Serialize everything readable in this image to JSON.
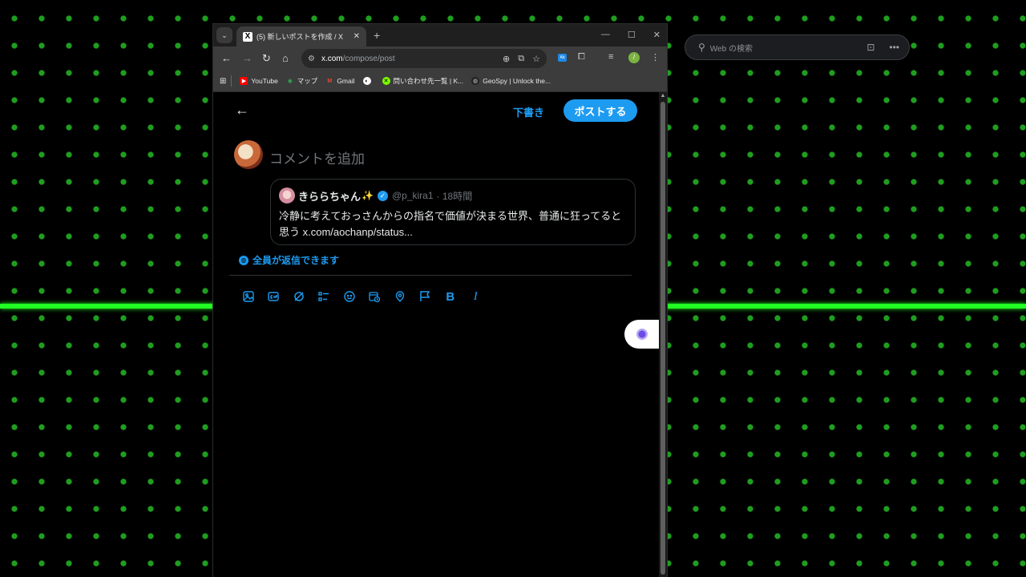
{
  "desktop": {
    "search_placeholder": "Web の検索"
  },
  "browser": {
    "tab_title": "(5) 新しいポストを作成 / X",
    "tab_favicon": "X",
    "url_host": "x.com",
    "url_path": "/compose/post",
    "bookmarks": [
      {
        "label": "YouTube",
        "color": "#ff0000"
      },
      {
        "label": "マップ",
        "color": "#34a853"
      },
      {
        "label": "Gmail",
        "color": "#ea4335"
      },
      {
        "label": "",
        "color": "#ffffff"
      },
      {
        "label": "問い合わせ先一覧 | K...",
        "color": "#7cfc00"
      },
      {
        "label": "GeoSpy | Unlock the...",
        "color": "#888888"
      }
    ],
    "profile_initial": "/"
  },
  "compose": {
    "drafts_label": "下書き",
    "post_label": "ポストする",
    "comment_placeholder": "コメントを追加",
    "reply_setting": "全員が返信できます",
    "quote": {
      "name": "きららちゃん",
      "handle": "@p_kira1",
      "time": "· 18時間",
      "body": "冷静に考えておっさんからの指名で価値が決まる世界、普通に狂ってると思う x.com/aochanp/status..."
    },
    "toolbar_icons": [
      "image-icon",
      "gif-icon",
      "grok-icon",
      "poll-icon",
      "emoji-icon",
      "schedule-icon",
      "location-icon",
      "flag-icon",
      "bold-icon",
      "italic-icon"
    ],
    "bold_label": "B",
    "italic_label": "I"
  },
  "colors": {
    "accent": "#1d9bf0",
    "background": "#000000",
    "scanline": "#22ff22"
  }
}
